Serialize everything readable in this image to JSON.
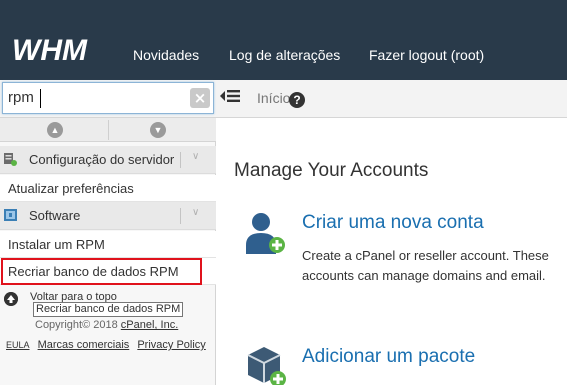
{
  "header": {
    "logo_text": "WHM",
    "nav": [
      "Novidades",
      "Log de alterações",
      "Fazer logout (root)"
    ]
  },
  "search": {
    "value": "rpm",
    "clear_icon": "x-icon"
  },
  "breadcrumb": {
    "home": "Início",
    "help_icon": "question-circle-icon"
  },
  "sidebar": {
    "sections": [
      {
        "label": "Configuração do servidor",
        "icon": "server-config-icon"
      },
      {
        "label": "Software",
        "icon": "software-icon"
      }
    ],
    "links": [
      "Atualizar preferências",
      "Instalar um RPM",
      "Recriar banco de dados RPM"
    ],
    "highlighted": "Recriar banco de dados RPM",
    "back_to_top": "Voltar para o topo",
    "tooltip": "Recriar banco de dados RPM",
    "copyright_prefix": "Copyright© 2018",
    "copyright_link": "cPanel, Inc.",
    "footer_links": [
      "EULA",
      "Marcas comerciais",
      "Privacy Policy"
    ]
  },
  "main": {
    "title": "Manage Your Accounts",
    "items": [
      {
        "title": "Criar uma nova conta",
        "description": "Create a cPanel or reseller account. These accounts can manage domains and email.",
        "icon": "add-user-icon"
      },
      {
        "title": "Adicionar um pacote",
        "description": "",
        "icon": "add-package-icon"
      }
    ]
  },
  "colors": {
    "topbar": "#293a4a",
    "link": "#1a6fb0",
    "highlight": "#e0121c"
  }
}
